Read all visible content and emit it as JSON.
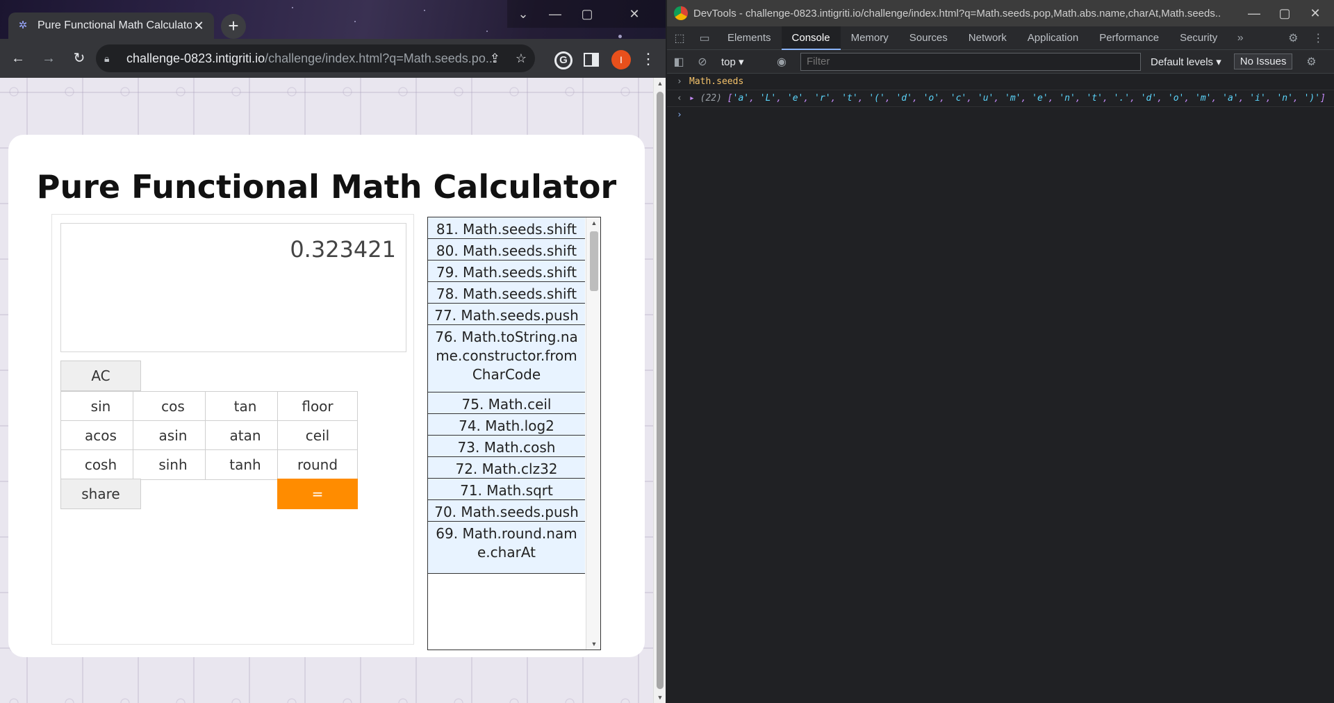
{
  "browser": {
    "tab_title": "Pure Functional Math Calculator",
    "tab_close": "✕",
    "new_tab": "+",
    "url_host": "challenge-0823.intigriti.io",
    "url_rest": "/challenge/index.html?q=Math.seeds.po...",
    "avatar_letter": "I"
  },
  "page": {
    "title": "Pure Functional Math Calculator",
    "display_value": "0.323421",
    "buttons": {
      "ac": "AC",
      "sin": "sin",
      "cos": "cos",
      "tan": "tan",
      "floor": "floor",
      "acos": "acos",
      "asin": "asin",
      "atan": "atan",
      "ceil": "ceil",
      "cosh": "cosh",
      "sinh": "sinh",
      "tanh": "tanh",
      "round": "round",
      "share": "share",
      "equals": "="
    },
    "history": [
      "81. Math.seeds.shift",
      "80. Math.seeds.shift",
      "79. Math.seeds.shift",
      "78. Math.seeds.shift",
      "77. Math.seeds.push",
      "76. Math.toString.name.constructor.fromCharCode",
      "75. Math.ceil",
      "74. Math.log2",
      "73. Math.cosh",
      "72. Math.clz32",
      "71. Math.sqrt",
      "70. Math.seeds.push",
      "69. Math.round.name.charAt"
    ]
  },
  "devtools": {
    "window_title": "DevTools - challenge-0823.intigriti.io/challenge/index.html?q=Math.seeds.pop,Math.abs.name,charAt,Math.seeds...",
    "tabs": [
      "Elements",
      "Console",
      "Memory",
      "Sources",
      "Network",
      "Application",
      "Performance",
      "Security"
    ],
    "context": "top",
    "filter_placeholder": "Filter",
    "levels": "Default levels",
    "issues": "No Issues",
    "console_input": "Math.seeds",
    "console_output_count": "(22)",
    "console_output_items": [
      "a",
      "L",
      "e",
      "r",
      "t",
      "(",
      "d",
      "o",
      "c",
      "u",
      "m",
      "e",
      "n",
      "t",
      ".",
      "d",
      "o",
      "m",
      "a",
      "i",
      "n",
      ")"
    ]
  }
}
